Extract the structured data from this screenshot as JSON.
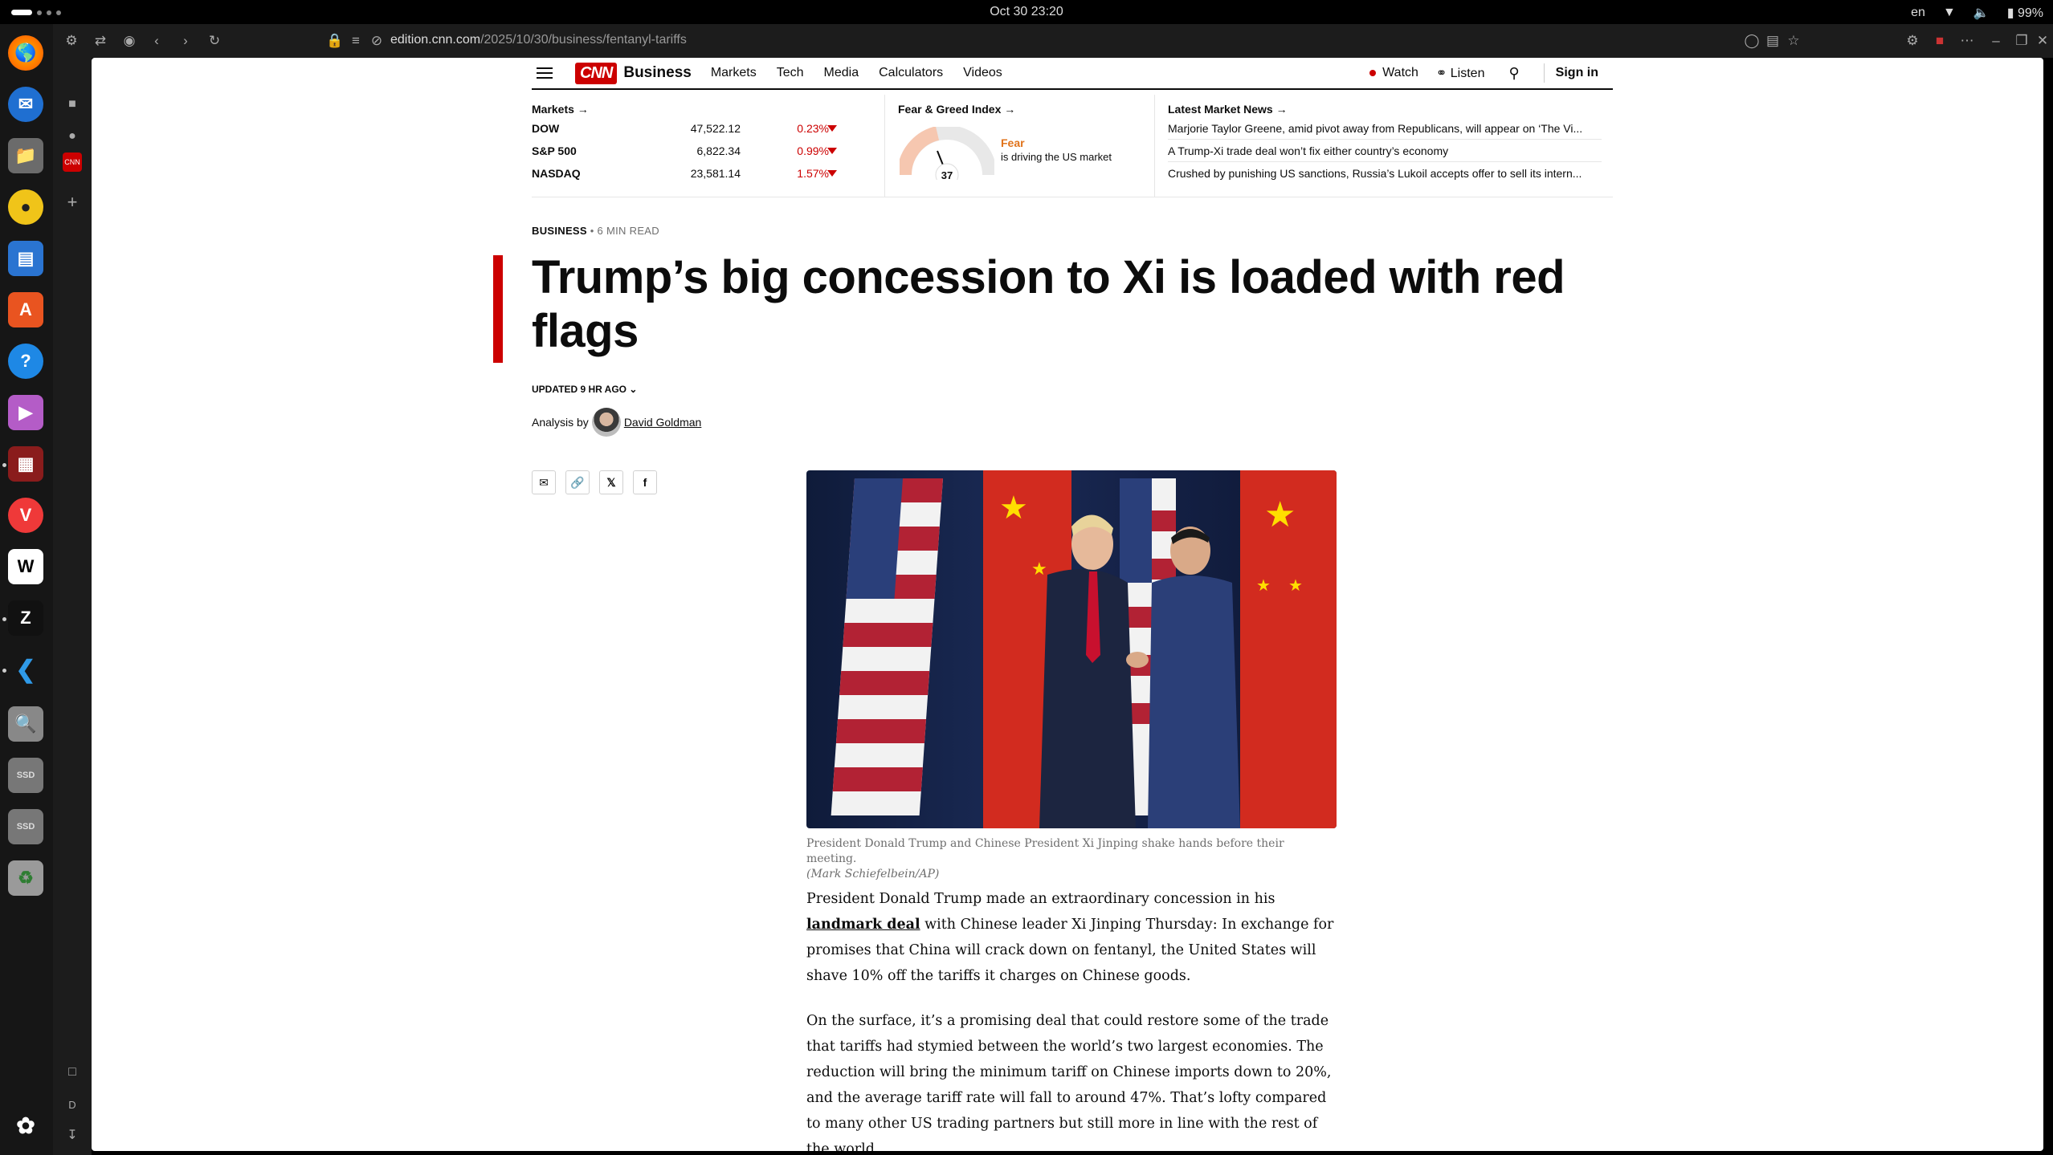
{
  "system": {
    "clock": "Oct 30  23:20",
    "lang": "en",
    "battery": "99%"
  },
  "browser": {
    "url_domain": "edition.cnn.com",
    "url_path": "/2025/10/30/business/fentanyl-tariffs",
    "sidebar_labels": [
      "D"
    ]
  },
  "nav": {
    "brand": "Business",
    "links": [
      "Markets",
      "Tech",
      "Media",
      "Calculators",
      "Videos"
    ],
    "watch": "Watch",
    "listen": "Listen",
    "sign_in": "Sign in"
  },
  "markets": {
    "title": "Markets →",
    "rows": [
      {
        "name": "DOW",
        "value": "47,522.12",
        "change": "0.23%"
      },
      {
        "name": "S&P 500",
        "value": "6,822.34",
        "change": "0.99%"
      },
      {
        "name": "NASDAQ",
        "value": "23,581.14",
        "change": "1.57%"
      }
    ],
    "fear_title": "Fear & Greed Index →",
    "fear_value": "37",
    "fear_label": "Fear",
    "fear_sub": "is driving the US market",
    "news_title": "Latest Market News →",
    "news": [
      "Marjorie Taylor Greene, amid pivot away from Republicans, will appear on ‘The Vi...",
      "A Trump-Xi trade deal won’t fix either country’s economy",
      "Crushed by punishing US sanctions, Russia’s Lukoil accepts offer to sell its intern..."
    ]
  },
  "article": {
    "section": "BUSINESS",
    "read_time": " • 6 MIN READ",
    "headline": "Trump’s big concession to Xi is loaded with red flags",
    "updated": "UPDATED 9 HR AGO",
    "analysis_by": "Analysis by",
    "author": "David Goldman",
    "caption": "President Donald Trump and Chinese President Xi Jinping shake hands before their meeting.",
    "credit": "(Mark Schiefelbein/AP)",
    "p1_a": "President Donald Trump made an extraordinary concession in his ",
    "p1_link": "landmark deal",
    "p1_b": " with Chinese leader Xi Jinping Thursday: In exchange for promises that China will crack down on fentanyl, the United States will shave 10% off the tariffs it charges on Chinese goods.",
    "p2": "On the surface, it’s a promising deal that could restore some of the trade that tariffs had stymied between the world’s two largest economies. The reduction will bring the minimum tariff on Chinese imports down to 20%, and the average tariff rate will fall to around 47%. That’s lofty compared to many other US trading partners but still more in line with the rest of the world."
  },
  "colors": {
    "accent": "#cc0000",
    "text": "#0c0c0c",
    "muted": "#6e6e6e",
    "fear_orange": "#e0731b"
  }
}
